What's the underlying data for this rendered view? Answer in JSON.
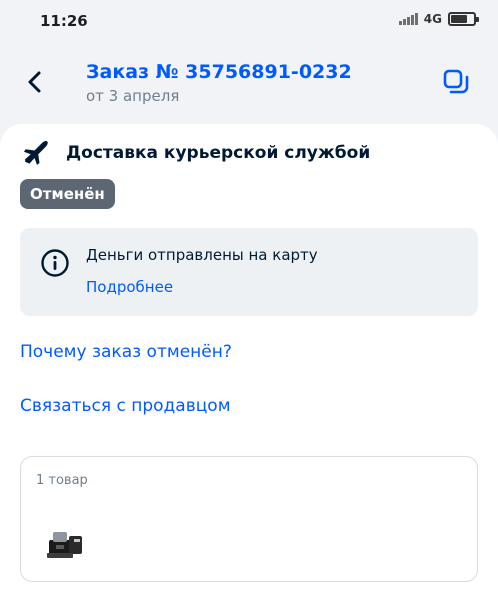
{
  "status_bar": {
    "time": "11:26",
    "network": "4G"
  },
  "header": {
    "title": "Заказ № 35756891-0232",
    "date": "от 3 апреля"
  },
  "delivery": {
    "label": "Доставка курьерской службой"
  },
  "status_badge": {
    "text": "Отменён",
    "color": "#5c6773"
  },
  "info_box": {
    "message": "Деньги отправлены на карту",
    "link": "Подробнее"
  },
  "links": {
    "why_cancelled": "Почему заказ отменён?",
    "contact_seller": "Связаться с продавцом"
  },
  "items": {
    "count_label": "1 товар"
  },
  "icons": [
    "back-arrow-icon",
    "copy-icon",
    "plane-icon",
    "info-icon",
    "product-thumbnail"
  ],
  "colors": {
    "accent": "#005bff",
    "text": "#001a34",
    "secondary": "#707f8d",
    "background": "#f2f3f6"
  }
}
